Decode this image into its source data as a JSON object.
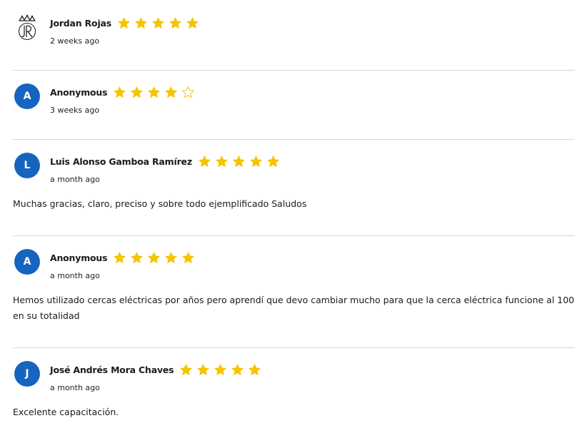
{
  "colors": {
    "avatar_bg": "#1565c0",
    "star_filled": "#f5c400",
    "star_empty_stroke": "#f5c400",
    "divider": "#d6d6d6"
  },
  "reviews": [
    {
      "name": "Jordan Rojas",
      "avatar_type": "logo",
      "avatar_icon": "jr-crown-monogram-icon",
      "rating": 5,
      "date": "2 weeks ago",
      "text": ""
    },
    {
      "name": "Anonymous",
      "avatar_type": "initial",
      "avatar_initial": "A",
      "rating": 4,
      "date": "3 weeks ago",
      "text": ""
    },
    {
      "name": "Luis Alonso Gamboa Ramírez",
      "avatar_type": "initial",
      "avatar_initial": "L",
      "rating": 5,
      "date": "a month ago",
      "text": "Muchas gracias, claro, preciso y sobre todo ejemplificado Saludos"
    },
    {
      "name": "Anonymous",
      "avatar_type": "initial",
      "avatar_initial": "A",
      "rating": 5,
      "date": "a month ago",
      "text": "Hemos utilizado cercas eléctricas por años pero aprendí que devo cambiar mucho para que la cerca eléctrica funcione al 100 en su totalidad"
    },
    {
      "name": "José Andrés Mora Chaves",
      "avatar_type": "initial",
      "avatar_initial": "J",
      "rating": 5,
      "date": "a month ago",
      "text": "Excelente capacitación."
    }
  ]
}
